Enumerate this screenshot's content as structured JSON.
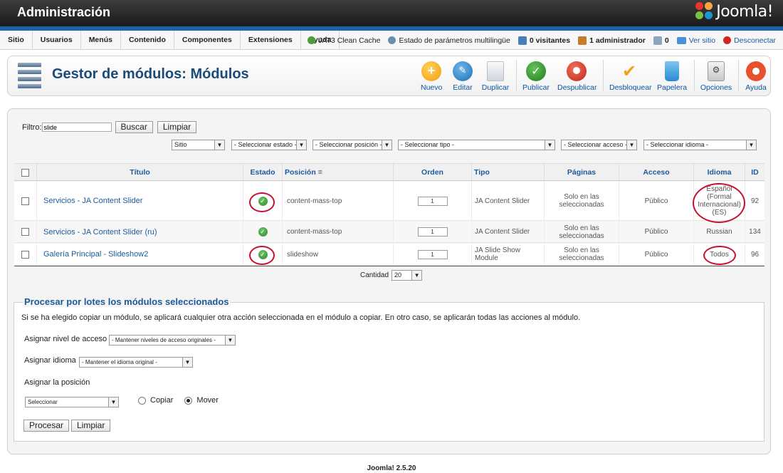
{
  "header": {
    "title": "Administración",
    "logo_text": "Joomla!"
  },
  "menu": [
    "Sitio",
    "Usuarios",
    "Menús",
    "Contenido",
    "Componentes",
    "Extensiones",
    "Ayuda"
  ],
  "status": {
    "cache": "JAT3 Clean Cache",
    "multilang": "Estado de parámetros multilingüe",
    "visitors": "0 visitantes",
    "admins": "1 administrador",
    "messages": "0",
    "view_site": "Ver sitio",
    "logout": "Desconectar"
  },
  "page_title": "Gestor de módulos: Módulos",
  "toolbar": {
    "new": "Nuevo",
    "edit": "Editar",
    "duplicate": "Duplicar",
    "publish": "Publicar",
    "unpublish": "Despublicar",
    "checkin": "Desbloquear",
    "trash": "Papelera",
    "options": "Opciones",
    "help": "Ayuda"
  },
  "filter": {
    "label": "Filtro:",
    "value": "slide",
    "search": "Buscar",
    "clear": "Limpiar",
    "site": "Sitio",
    "state": "- Seleccionar estado -",
    "position": "- Seleccionar posición -",
    "type": "- Seleccionar tipo -",
    "access": "- Seleccionar acceso -",
    "language": "- Seleccionar idioma -"
  },
  "columns": {
    "title": "Título",
    "status": "Estado",
    "position": "Posición",
    "order": "Orden",
    "type": "Tipo",
    "pages": "Páginas",
    "access": "Acceso",
    "language": "Idioma",
    "id": "ID"
  },
  "rows": [
    {
      "title": "Servicios - JA Content Slider",
      "position": "content-mass-top",
      "order": "1",
      "type": "JA Content Slider",
      "pages": "Solo en las seleccionadas",
      "access": "Público",
      "language": "Español (Formal Internacional) (ES)",
      "id": "92"
    },
    {
      "title": "Servicios - JA Content Slider (ru)",
      "position": "content-mass-top",
      "order": "1",
      "type": "JA Content Slider",
      "pages": "Solo en las seleccionadas",
      "access": "Público",
      "language": "Russian",
      "id": "134"
    },
    {
      "title": "Galería Principal - Slideshow2",
      "position": "slideshow",
      "order": "1",
      "type": "JA Slide Show Module",
      "pages": "Solo en las seleccionadas",
      "access": "Público",
      "language": "Todos",
      "id": "96"
    }
  ],
  "pagination": {
    "label": "Cantidad",
    "value": "20"
  },
  "batch": {
    "legend": "Procesar por lotes los módulos seleccionados",
    "description": "Si se ha elegido copiar un módulo, se aplicará cualquier otra acción seleccionada en el módulo a copiar. En otro caso, se aplicarán todas las acciones al módulo.",
    "access_label": "Asignar nivel de acceso",
    "access_value": "- Mantener niveles de acceso originales -",
    "language_label": "Asignar idioma",
    "language_value": "- Mantener el idioma original -",
    "position_label": "Asignar la posición",
    "position_value": "Seleccionar",
    "copy": "Copiar",
    "move": "Mover",
    "process": "Procesar",
    "clear": "Limpiar"
  },
  "footer": "Joomla! 2.5.20"
}
